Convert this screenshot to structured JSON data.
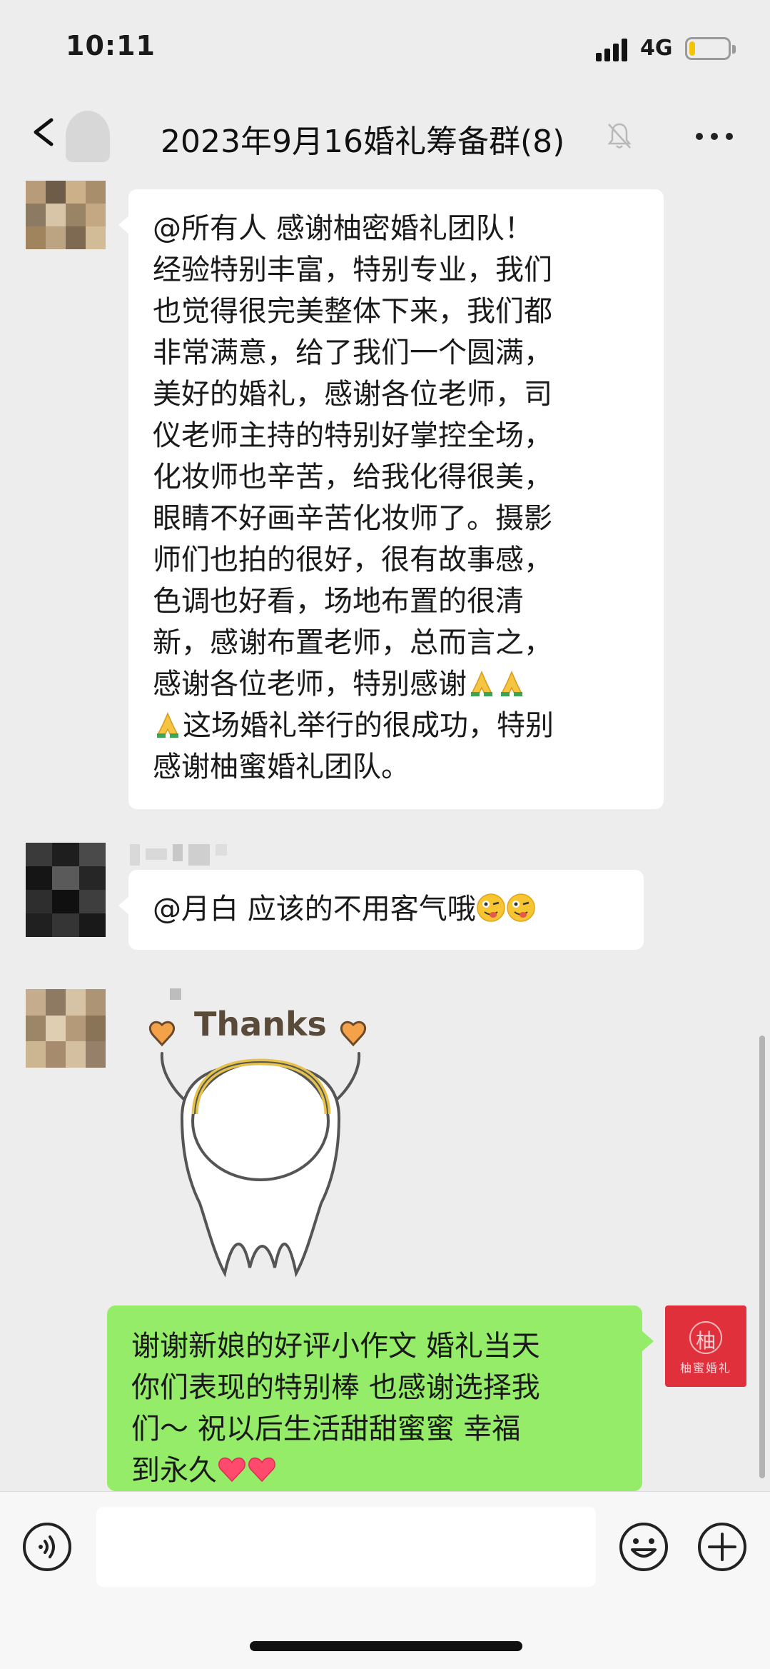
{
  "status_bar": {
    "time": "10:11",
    "network": "4G",
    "battery_level": 0.15
  },
  "nav": {
    "title": "2023年9月16婚礼筹备群(8)",
    "muted": true,
    "icons": [
      "back-icon",
      "mute-bell-icon",
      "more-icon"
    ]
  },
  "messages": [
    {
      "sender": "other",
      "lines": [
        "@所有人  感谢柚密婚礼团队！",
        "经验特别丰富，特别专业，我们",
        "也觉得很完美整体下来，我们都",
        "非常满意，给了我们一个圆满，",
        "美好的婚礼，感谢各位老师，司",
        "仪老师主持的特别好掌控全场，",
        "化妆师也辛苦，给我化得很美，",
        "眼睛不好画辛苦化妆师了。摄影",
        "师们也拍的很好，很有故事感，",
        "色调也好看，场地布置的很清",
        "新，感谢布置老师，总而言之，",
        "感谢各位老师，特别感谢",
        "这场婚礼举行的很成功，特别",
        "感谢柚蜜婚礼团队。"
      ],
      "emojis": [
        "folded-hands-emoji",
        "folded-hands-emoji",
        "folded-hands-emoji"
      ]
    },
    {
      "sender": "other",
      "text": "@月白 应该的不用客气哦",
      "emojis": [
        "winking-tongue-emoji",
        "winking-tongue-emoji"
      ]
    },
    {
      "sender": "other",
      "sticker": "Thanks",
      "sticker_icon": "thanks-sticker"
    },
    {
      "sender": "me",
      "lines": [
        "谢谢新娘的好评小作文 婚礼当天",
        "你们表现的特别棒 也感谢选择我",
        "们～ 祝以后生活甜甜蜜蜜  幸福",
        "到永久"
      ],
      "emojis": [
        "heart-emoji",
        "heart-emoji"
      ],
      "avatar_char": "柚",
      "avatar_text": "柚蜜婚礼"
    }
  ],
  "input_bar": {
    "icons": [
      "voice-icon",
      "emoji-icon",
      "plus-icon"
    ],
    "placeholder": ""
  },
  "colors": {
    "background": "#ededed",
    "my_bubble": "#95ec69",
    "other_bubble": "#ffffff",
    "brand_red": "#e0303c"
  }
}
